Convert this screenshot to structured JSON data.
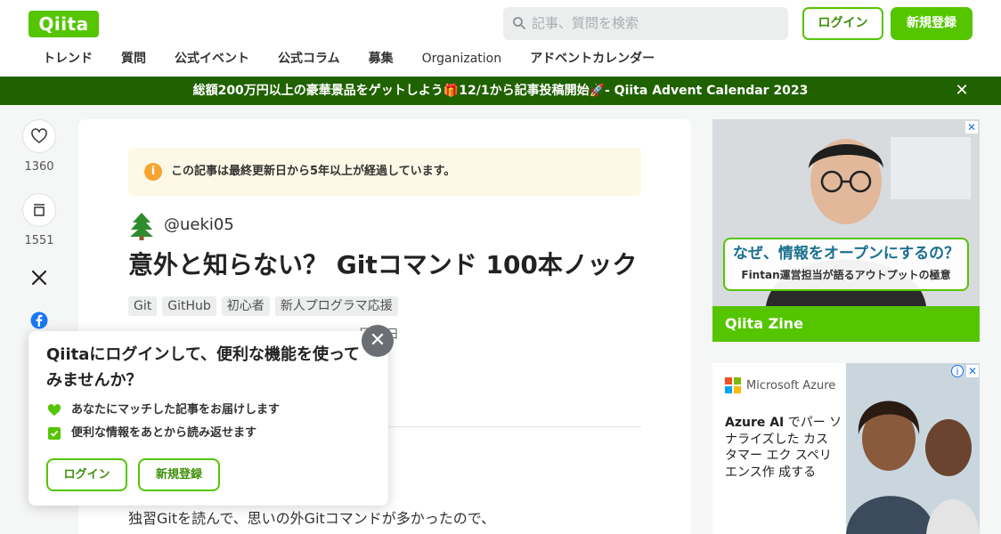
{
  "header": {
    "logo": "Qiita",
    "search_placeholder": "記事、質問を検索",
    "login_label": "ログイン",
    "signup_label": "新規登録",
    "nav": [
      "トレンド",
      "質問",
      "公式イベント",
      "公式コラム",
      "募集",
      "Organization",
      "アドベントカレンダー"
    ]
  },
  "banner": {
    "text": "総額200万円以上の豪華景品をゲットしよう🎁12/1から記事投稿開始🚀- Qiita Advent Calendar 2023",
    "close": "✕"
  },
  "side_actions": {
    "likes": "1360",
    "stocks": "1551"
  },
  "article": {
    "notice": "この記事は最終更新日から5年以上が経過しています。",
    "author": "@ueki05",
    "title": "意外と知らない？ Gitコマンド 100本ノック",
    "tags": [
      "Git",
      "GitHub",
      "初心者",
      "新人プログラマ応援"
    ],
    "date_fragment": "月28日",
    "body_first_line": "独習Gitを読んで、思いの外Gitコマンドが多かったので、"
  },
  "login_popup": {
    "title": "Qiitaにログインして、便利な機能を使ってみませんか？",
    "benefits": [
      "あなたにマッチした記事をお届けします",
      "便利な情報をあとから読み返せます"
    ],
    "login_label": "ログイン",
    "signup_label": "新規登録",
    "close": "✕"
  },
  "ads": {
    "zine": {
      "headline": "なぜ、情報をオープンにするの？",
      "sub": "Fintan運営担当が語るアウトプットの極意",
      "brand": "Qiita Zine"
    },
    "azure": {
      "brand": "Microsoft Azure",
      "text_bold": "Azure AI",
      "text_rest": " でパー ソ ナライズした カス タマー エク スペリ エンス作 成する"
    }
  },
  "colors": {
    "brand_green": "#55c500",
    "banner_green": "#206100",
    "notice_bg": "#fdf9e6"
  }
}
